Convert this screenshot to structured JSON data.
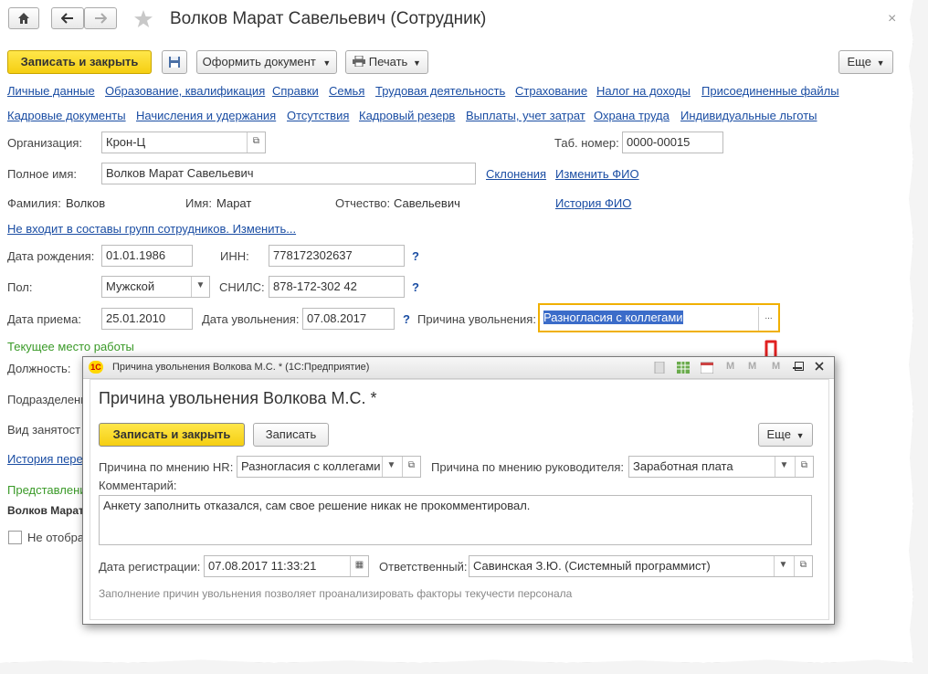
{
  "window": {
    "title": "Волков Марат Савельевич (Сотрудник)",
    "icons": [
      "home-icon",
      "back-arrow-icon",
      "forward-arrow-icon",
      "star-icon",
      "close-icon"
    ],
    "close_glyph": "×"
  },
  "toolbar": {
    "save_close": "Записать и закрыть",
    "make_document": "Оформить документ",
    "print": "Печать",
    "more": "Еще"
  },
  "tabs_row1": [
    "Личные данные",
    "Образование, квалификация",
    "Справки",
    "Семья",
    "Трудовая деятельность",
    "Страхование",
    "Налог на доходы",
    "Присоединенные файлы"
  ],
  "tabs_row2": [
    "Кадровые документы",
    "Начисления и удержания",
    "Отсутствия",
    "Кадровый резерв",
    "Выплаты, учет затрат",
    "Охрана труда",
    "Индивидуальные льготы"
  ],
  "form": {
    "org_label": "Организация:",
    "org_value": "Крон-Ц",
    "tab_label": "Таб. номер:",
    "tab_value": "0000-00015",
    "fullname_label": "Полное имя:",
    "fullname_value": "Волков Марат Савельевич",
    "declensions": "Склонения",
    "change_fio": "Изменить ФИО",
    "fio_history": "История ФИО",
    "surname_label": "Фамилия:",
    "surname_value": "Волков",
    "name_label": "Имя:",
    "name_value": "Марат",
    "patronymic_label": "Отчество:",
    "patronymic_value": "Савельевич",
    "groups_link": "Не входит в составы групп сотрудников. Изменить...",
    "birth_label": "Дата рождения:",
    "birth_value": "01.01.1986",
    "inn_label": "ИНН:",
    "inn_value": "778172302637",
    "gender_label": "Пол:",
    "gender_value": "Мужской",
    "snils_label": "СНИЛС:",
    "snils_value": "878-172-302 42",
    "hire_label": "Дата приема:",
    "hire_value": "25.01.2010",
    "dismiss_label": "Дата увольнения:",
    "dismiss_value": "07.08.2017",
    "reason_label": "Причина увольнения:",
    "reason_value": "Разногласия с коллегами",
    "help": "?",
    "current_work": "Текущее место работы",
    "position_label": "Должность:",
    "department_label": "Подразделени",
    "employment_label": "Вид занятост",
    "history_link": "История пере",
    "representation": "Представлени",
    "person_short": "Волков Марат",
    "not_show": "Не отобра"
  },
  "modal": {
    "window_title": "Причина увольнения Волкова М.С. * (1С:Предприятие)",
    "heading": "Причина увольнения Волкова М.С. *",
    "save_close": "Записать и закрыть",
    "save": "Записать",
    "more": "Еще",
    "hr_reason_label": "Причина по мнению HR:",
    "hr_reason_value": "Разногласия с коллегами",
    "mgr_reason_label": "Причина по мнению руководителя:",
    "mgr_reason_value": "Заработная плата",
    "comment_label": "Комментарий:",
    "comment_value": "Анкету заполнить отказался, сам свое решение никак не прокомментировал.",
    "reg_date_label": "Дата регистрации:",
    "reg_date_value": "07.08.2017 11:33:21",
    "responsible_label": "Ответственный:",
    "responsible_value": "Савинская З.Ю. (Системный программист)",
    "hint": "Заполнение причин увольнения позволяет проанализировать факторы текучести персонала",
    "m_glyph": "M"
  },
  "colors": {
    "accent_yellow": "#f5cf12",
    "link_blue": "#1a4da3",
    "green": "#3a9a28",
    "arrow_red": "#e02020",
    "focus_orange": "#f0b000"
  }
}
